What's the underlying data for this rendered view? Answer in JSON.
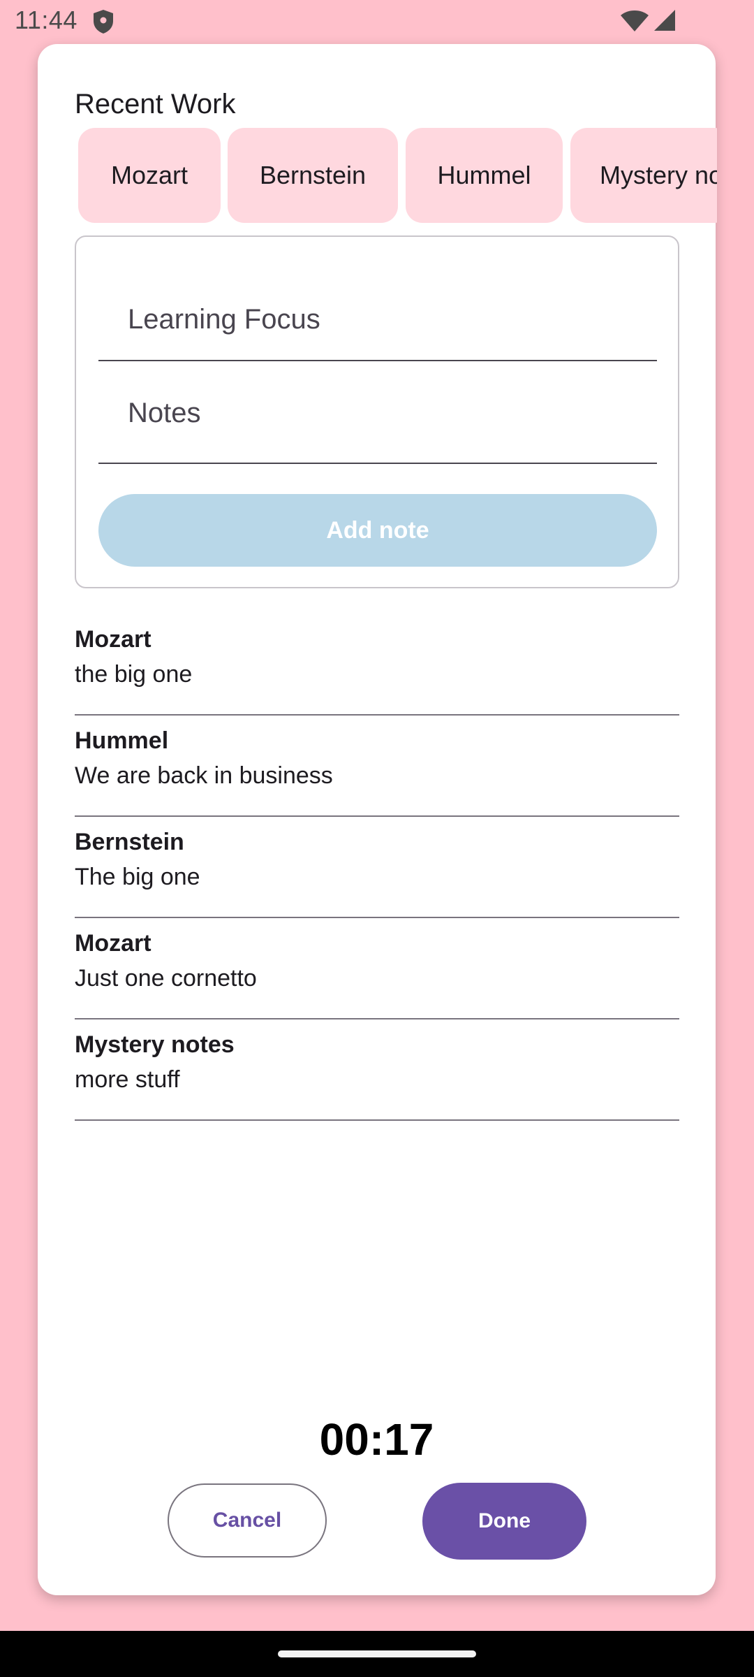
{
  "status_bar": {
    "time": "11:44",
    "icons": [
      "shield-icon",
      "wifi-icon",
      "signal-icon"
    ]
  },
  "recent_work": {
    "title": "Recent Work",
    "chips": [
      "Mozart",
      "Bernstein",
      "Hummel",
      "Mystery notes"
    ]
  },
  "form": {
    "learning_focus": {
      "placeholder": "Learning Focus",
      "value": ""
    },
    "notes": {
      "placeholder": "Notes",
      "value": ""
    },
    "add_button_label": "Add note"
  },
  "notes": [
    {
      "title": "Mozart",
      "body": "the big one"
    },
    {
      "title": "Hummel",
      "body": "We are back in business"
    },
    {
      "title": "Bernstein",
      "body": "The big one"
    },
    {
      "title": "Mozart",
      "body": "Just one cornetto"
    },
    {
      "title": "Mystery notes",
      "body": "more stuff"
    }
  ],
  "timer": "00:17",
  "actions": {
    "cancel_label": "Cancel",
    "done_label": "Done"
  },
  "colors": {
    "background": "#ffc0cb",
    "chip": "#ffd8df",
    "add_button_disabled": "#b8d7e8",
    "primary": "#6a50a7"
  }
}
